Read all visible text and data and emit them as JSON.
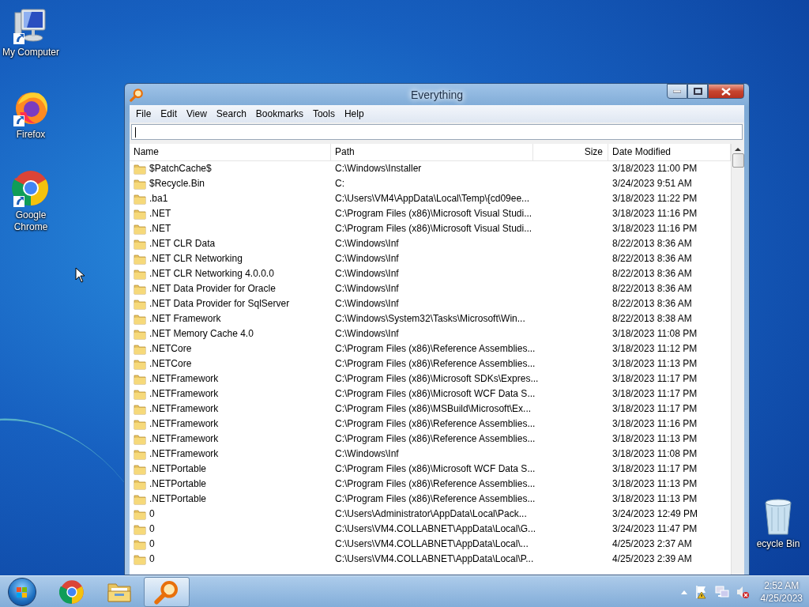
{
  "desktop_icons": [
    {
      "kind": "computer",
      "label": "My Computer"
    },
    {
      "kind": "firefox",
      "label": "Firefox"
    },
    {
      "kind": "chrome",
      "label": "Google Chrome"
    },
    {
      "kind": "recycle",
      "label": "ecycle Bin"
    }
  ],
  "window": {
    "title": "Everything",
    "menu": [
      "File",
      "Edit",
      "View",
      "Search",
      "Bookmarks",
      "Tools",
      "Help"
    ],
    "columns": [
      "Name",
      "Path",
      "Size",
      "Date Modified"
    ],
    "rows": [
      {
        "name": "$PatchCache$",
        "path": "C:\\Windows\\Installer",
        "date": "3/18/2023 11:00 PM"
      },
      {
        "name": "$Recycle.Bin",
        "path": "C:",
        "date": "3/24/2023 9:51 AM"
      },
      {
        "name": ".ba1",
        "path": "C:\\Users\\VM4\\AppData\\Local\\Temp\\{cd09ee...",
        "date": "3/18/2023 11:22 PM"
      },
      {
        "name": ".NET",
        "path": "C:\\Program Files (x86)\\Microsoft Visual Studi...",
        "date": "3/18/2023 11:16 PM"
      },
      {
        "name": ".NET",
        "path": "C:\\Program Files (x86)\\Microsoft Visual Studi...",
        "date": "3/18/2023 11:16 PM"
      },
      {
        "name": ".NET CLR Data",
        "path": "C:\\Windows\\Inf",
        "date": "8/22/2013 8:36 AM"
      },
      {
        "name": ".NET CLR Networking",
        "path": "C:\\Windows\\Inf",
        "date": "8/22/2013 8:36 AM"
      },
      {
        "name": ".NET CLR Networking 4.0.0.0",
        "path": "C:\\Windows\\Inf",
        "date": "8/22/2013 8:36 AM"
      },
      {
        "name": ".NET Data Provider for Oracle",
        "path": "C:\\Windows\\Inf",
        "date": "8/22/2013 8:36 AM"
      },
      {
        "name": ".NET Data Provider for SqlServer",
        "path": "C:\\Windows\\Inf",
        "date": "8/22/2013 8:36 AM"
      },
      {
        "name": ".NET Framework",
        "path": "C:\\Windows\\System32\\Tasks\\Microsoft\\Win...",
        "date": "8/22/2013 8:38 AM"
      },
      {
        "name": ".NET Memory Cache 4.0",
        "path": "C:\\Windows\\Inf",
        "date": "3/18/2023 11:08 PM"
      },
      {
        "name": ".NETCore",
        "path": "C:\\Program Files (x86)\\Reference Assemblies...",
        "date": "3/18/2023 11:12 PM"
      },
      {
        "name": ".NETCore",
        "path": "C:\\Program Files (x86)\\Reference Assemblies...",
        "date": "3/18/2023 11:13 PM"
      },
      {
        "name": ".NETFramework",
        "path": "C:\\Program Files (x86)\\Microsoft SDKs\\Expres...",
        "date": "3/18/2023 11:17 PM"
      },
      {
        "name": ".NETFramework",
        "path": "C:\\Program Files (x86)\\Microsoft WCF Data S...",
        "date": "3/18/2023 11:17 PM"
      },
      {
        "name": ".NETFramework",
        "path": "C:\\Program Files (x86)\\MSBuild\\Microsoft\\Ex...",
        "date": "3/18/2023 11:17 PM"
      },
      {
        "name": ".NETFramework",
        "path": "C:\\Program Files (x86)\\Reference Assemblies...",
        "date": "3/18/2023 11:16 PM"
      },
      {
        "name": ".NETFramework",
        "path": "C:\\Program Files (x86)\\Reference Assemblies...",
        "date": "3/18/2023 11:13 PM"
      },
      {
        "name": ".NETFramework",
        "path": "C:\\Windows\\Inf",
        "date": "3/18/2023 11:08 PM"
      },
      {
        "name": ".NETPortable",
        "path": "C:\\Program Files (x86)\\Microsoft WCF Data S...",
        "date": "3/18/2023 11:17 PM"
      },
      {
        "name": ".NETPortable",
        "path": "C:\\Program Files (x86)\\Reference Assemblies...",
        "date": "3/18/2023 11:13 PM"
      },
      {
        "name": ".NETPortable",
        "path": "C:\\Program Files (x86)\\Reference Assemblies...",
        "date": "3/18/2023 11:13 PM"
      },
      {
        "name": "0",
        "path": "C:\\Users\\Administrator\\AppData\\Local\\Pack...",
        "date": "3/24/2023 12:49 PM"
      },
      {
        "name": "0",
        "path": "C:\\Users\\VM4.COLLABNET\\AppData\\Local\\G...",
        "date": "3/24/2023 11:47 PM"
      },
      {
        "name": "0",
        "path": "C:\\Users\\VM4.COLLABNET\\AppData\\Local\\...",
        "date": "4/25/2023 2:37 AM"
      },
      {
        "name": "0",
        "path": "C:\\Users\\VM4.COLLABNET\\AppData\\Local\\P...",
        "date": "4/25/2023 2:39 AM"
      }
    ]
  },
  "taskbar": {
    "apps": [
      {
        "kind": "chrome",
        "selected": false
      },
      {
        "kind": "explorer",
        "selected": false
      },
      {
        "kind": "search",
        "selected": true
      }
    ],
    "tray": [
      {
        "kind": "arrow"
      },
      {
        "kind": "flag"
      },
      {
        "kind": "network"
      },
      {
        "kind": "volume-muted"
      }
    ],
    "clock": {
      "time": "2:52 AM",
      "date": "4/25/2023"
    }
  }
}
